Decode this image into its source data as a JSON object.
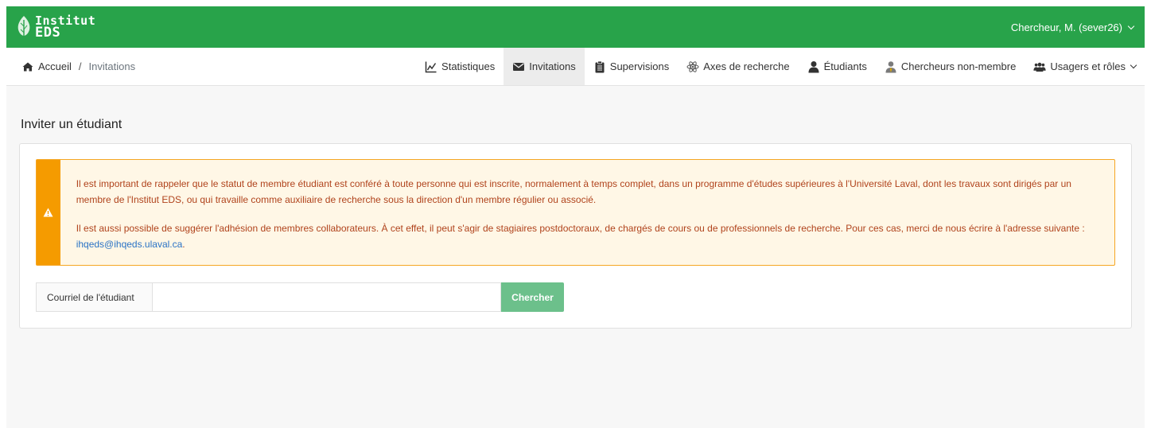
{
  "brand": {
    "line1": "Institut",
    "line2": "EDS",
    "color": "#28a34a"
  },
  "user": {
    "label": "Chercheur, M. (sever26)"
  },
  "breadcrumb": {
    "home": "Accueil",
    "separator": "/",
    "current": "Invitations"
  },
  "nav": {
    "items": [
      {
        "label": "Statistiques",
        "icon": "chart-line-icon"
      },
      {
        "label": "Invitations",
        "icon": "envelope-icon",
        "active": true
      },
      {
        "label": "Supervisions",
        "icon": "clipboard-icon"
      },
      {
        "label": "Axes de recherche",
        "icon": "atom-icon"
      },
      {
        "label": "Étudiants",
        "icon": "user-icon"
      },
      {
        "label": "Chercheurs non-membre",
        "icon": "user-tie-icon"
      },
      {
        "label": "Usagers et rôles",
        "icon": "users-icon"
      }
    ]
  },
  "page": {
    "title": "Inviter un étudiant"
  },
  "alert": {
    "icon": "warning-icon",
    "p1": "Il est important de rappeler que le statut de membre étudiant est conféré à toute personne qui est inscrite, normalement à temps complet, dans un programme d'études supérieures à l'Université Laval, dont les travaux sont dirigés par un membre de l'Institut EDS, ou qui travaille comme auxiliaire de recherche sous la direction d'un membre régulier ou associé.",
    "p2_before": "Il est aussi possible de suggérer l'adhésion de membres collaborateurs. À cet effet, il peut s'agir de stagiaires postdoctoraux, de chargés de cours ou de professionnels de recherche. Pour ces cas, merci de nous écrire à l'adresse suivante : ",
    "p2_link": "ihqeds@ihqeds.ulaval.ca",
    "p2_after": ".",
    "colors": {
      "accent": "#f59b00",
      "background": "#fff7e6",
      "text": "#b0431c"
    }
  },
  "search": {
    "label": "Courriel de l'étudiant",
    "value": "",
    "button": "Chercher",
    "button_color": "#6cc08b"
  }
}
